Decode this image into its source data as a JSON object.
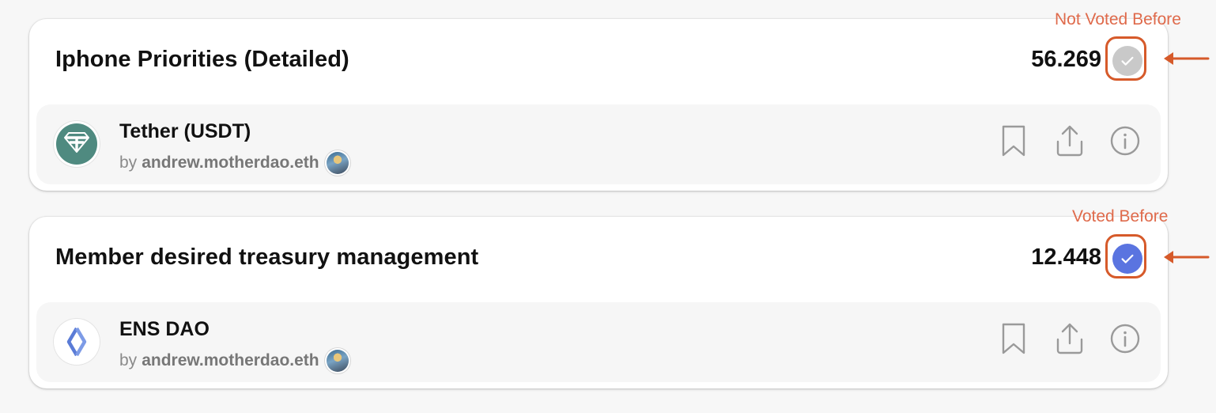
{
  "colors": {
    "background": "#f7f7f7",
    "card": "#ffffff",
    "subcard": "#f6f6f6",
    "not_voted": "#c9c9c9",
    "voted": "#5a74e0",
    "annotation": "#df6a4b",
    "annotation_stroke": "#d65a2a",
    "tether": "#4f8a80",
    "ens": "#5a7bd6"
  },
  "cards": [
    {
      "title": "Iphone Priorities (Detailed)",
      "score": "56.269",
      "vote_state": "not-voted",
      "project": {
        "name": "Tether (USDT)",
        "by": "by",
        "author": "andrew.motherdao.eth",
        "logo_icon": "tether-logo-icon"
      },
      "annotation": "Not Voted Before"
    },
    {
      "title": "Member desired treasury management",
      "score": "12.448",
      "vote_state": "voted",
      "project": {
        "name": "ENS DAO",
        "by": "by",
        "author": "andrew.motherdao.eth",
        "logo_icon": "ens-logo-icon"
      },
      "annotation": "Voted Before"
    }
  ],
  "actions": [
    "bookmark-icon",
    "share-icon",
    "info-icon"
  ]
}
